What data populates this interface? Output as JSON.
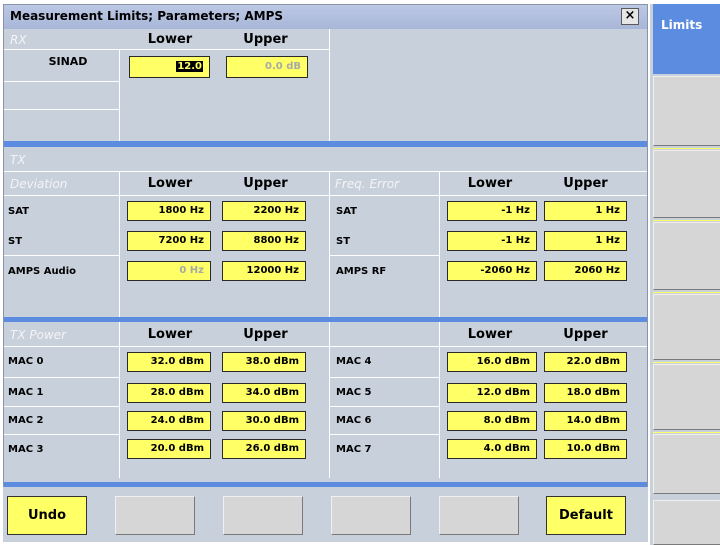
{
  "window": {
    "title": "Measurement Limits; Parameters; AMPS",
    "close_symbol": "×"
  },
  "rx": {
    "section": "RX",
    "col_lower": "Lower",
    "col_upper": "Upper",
    "rows": [
      {
        "label": "SINAD",
        "lower": "12.0",
        "upper": "0.0 dB"
      }
    ]
  },
  "tx": {
    "section": "TX"
  },
  "deviation": {
    "section": "Deviation",
    "col_lower": "Lower",
    "col_upper": "Upper",
    "rows": [
      {
        "label": "SAT",
        "lower": "1800 Hz",
        "upper": "2200 Hz"
      },
      {
        "label": "ST",
        "lower": "7200 Hz",
        "upper": "8800 Hz"
      },
      {
        "label": "AMPS Audio",
        "lower": "0 Hz",
        "upper": "12000 Hz"
      }
    ]
  },
  "freq_error": {
    "section": "Freq. Error",
    "col_lower": "Lower",
    "col_upper": "Upper",
    "rows": [
      {
        "label": "SAT",
        "lower": "-1 Hz",
        "upper": "1 Hz"
      },
      {
        "label": "ST",
        "lower": "-1 Hz",
        "upper": "1 Hz"
      },
      {
        "label": "AMPS RF",
        "lower": "-2060 Hz",
        "upper": "2060 Hz"
      }
    ]
  },
  "tx_power": {
    "section": "TX Power",
    "col_lower": "Lower",
    "col_upper": "Upper",
    "left_rows": [
      {
        "label": "MAC 0",
        "lower": "32.0 dBm",
        "upper": "38.0 dBm"
      },
      {
        "label": "MAC 1",
        "lower": "28.0 dBm",
        "upper": "34.0 dBm"
      },
      {
        "label": "MAC 2",
        "lower": "24.0 dBm",
        "upper": "30.0 dBm"
      },
      {
        "label": "MAC 3",
        "lower": "20.0 dBm",
        "upper": "26.0 dBm"
      }
    ],
    "right_rows": [
      {
        "label": "MAC 4",
        "lower": "16.0 dBm",
        "upper": "22.0 dBm"
      },
      {
        "label": "MAC 5",
        "lower": "12.0 dBm",
        "upper": "18.0 dBm"
      },
      {
        "label": "MAC 6",
        "lower": "8.0 dBm",
        "upper": "14.0 dBm"
      },
      {
        "label": "MAC 7",
        "lower": "4.0 dBm",
        "upper": "10.0 dBm"
      }
    ]
  },
  "softkeys": {
    "undo": "Undo",
    "default": "Default"
  },
  "side_menu": {
    "limits": "Limits"
  },
  "colors": {
    "field": "#ffff66",
    "accent": "#5b8ce0",
    "panel": "#c8d0dc"
  }
}
